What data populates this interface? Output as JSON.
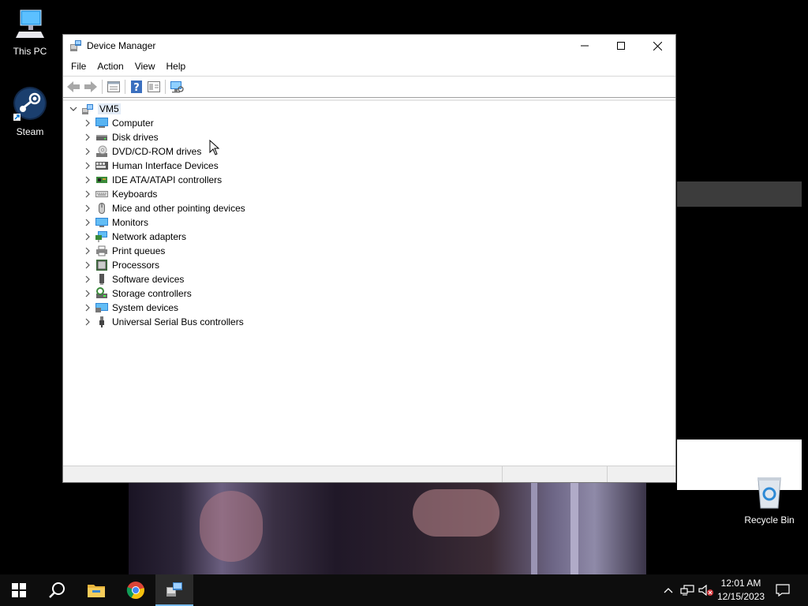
{
  "desktop": {
    "icons": [
      {
        "label": "This PC",
        "icon": "this-pc-icon"
      },
      {
        "label": "Steam",
        "icon": "steam-icon"
      },
      {
        "label": "Recycle Bin",
        "icon": "recycle-bin-icon"
      }
    ]
  },
  "window": {
    "title": "Device Manager",
    "controls": {
      "minimize": "minimize-icon",
      "maximize": "maximize-icon",
      "close": "close-icon"
    },
    "menu": [
      "File",
      "Action",
      "View",
      "Help"
    ],
    "toolbar": [
      "back-arrow-icon",
      "forward-arrow-icon",
      "properties-icon",
      "help-icon",
      "update-driver-icon",
      "scan-hardware-icon"
    ],
    "tree": {
      "root": "VM5",
      "items": [
        {
          "label": "Computer",
          "icon": "computer-icon"
        },
        {
          "label": "Disk drives",
          "icon": "disk-drive-icon"
        },
        {
          "label": "DVD/CD-ROM drives",
          "icon": "dvd-drive-icon"
        },
        {
          "label": "Human Interface Devices",
          "icon": "hid-icon"
        },
        {
          "label": "IDE ATA/ATAPI controllers",
          "icon": "ide-controller-icon"
        },
        {
          "label": "Keyboards",
          "icon": "keyboard-icon"
        },
        {
          "label": "Mice and other pointing devices",
          "icon": "mouse-icon"
        },
        {
          "label": "Monitors",
          "icon": "monitor-icon"
        },
        {
          "label": "Network adapters",
          "icon": "network-adapter-icon"
        },
        {
          "label": "Print queues",
          "icon": "printer-icon"
        },
        {
          "label": "Processors",
          "icon": "processor-icon"
        },
        {
          "label": "Software devices",
          "icon": "software-device-icon"
        },
        {
          "label": "Storage controllers",
          "icon": "storage-controller-icon"
        },
        {
          "label": "System devices",
          "icon": "system-device-icon"
        },
        {
          "label": "Universal Serial Bus controllers",
          "icon": "usb-icon"
        }
      ]
    }
  },
  "taskbar": {
    "items": [
      "start-icon",
      "search-icon",
      "file-explorer-icon",
      "chrome-icon",
      "device-manager-icon"
    ],
    "tray": [
      "chevron-up-icon",
      "network-icon",
      "volume-muted-icon",
      "action-center-icon"
    ],
    "clock": {
      "time": "12:01 AM",
      "date": "12/15/2023"
    }
  },
  "colors": {
    "accent": "#0078d7",
    "taskbar": "#0d0d0d",
    "selection": "#e3ecf7"
  }
}
